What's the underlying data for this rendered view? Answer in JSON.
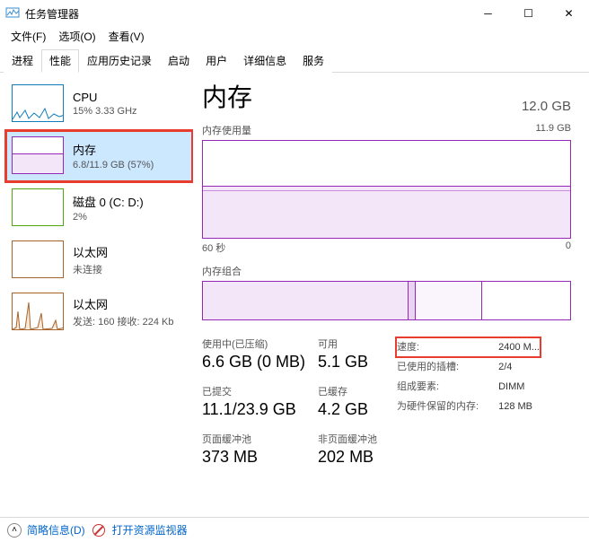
{
  "window": {
    "title": "任务管理器"
  },
  "menu": {
    "file": "文件(F)",
    "options": "选项(O)",
    "view": "查看(V)"
  },
  "tabs": [
    "进程",
    "性能",
    "应用历史记录",
    "启动",
    "用户",
    "详细信息",
    "服务"
  ],
  "sidebar": {
    "cpu": {
      "name": "CPU",
      "sub": "15% 3.33 GHz"
    },
    "mem": {
      "name": "内存",
      "sub": "6.8/11.9 GB (57%)"
    },
    "disk": {
      "name": "磁盘 0 (C: D:)",
      "sub": "2%"
    },
    "eth0": {
      "name": "以太网",
      "sub": "未连接"
    },
    "eth1": {
      "name": "以太网",
      "sub": "发送: 160 接收: 224 Kb"
    }
  },
  "detail": {
    "title": "内存",
    "capacity": "12.0 GB",
    "usage_label": "内存使用量",
    "usage_max": "11.9 GB",
    "axis_left": "60 秒",
    "axis_right": "0",
    "comp_label": "内存组合",
    "stats": {
      "inuse_lbl": "使用中(已压缩)",
      "inuse_val": "6.6 GB (0 MB)",
      "avail_lbl": "可用",
      "avail_val": "5.1 GB",
      "commit_lbl": "已提交",
      "commit_val": "11.1/23.9 GB",
      "cached_lbl": "已缓存",
      "cached_val": "4.2 GB",
      "paged_lbl": "页面缓冲池",
      "paged_val": "373 MB",
      "nonpaged_lbl": "非页面缓冲池",
      "nonpaged_val": "202 MB"
    },
    "meta": {
      "speed_k": "速度:",
      "speed_v": "2400 M...",
      "slots_k": "已使用的插槽:",
      "slots_v": "2/4",
      "form_k": "组成要素:",
      "form_v": "DIMM",
      "hw_k": "为硬件保留的内存:",
      "hw_v": "128 MB"
    }
  },
  "footer": {
    "less": "简略信息(D)",
    "resmon": "打开资源监视器"
  },
  "chart_data": {
    "type": "area",
    "title": "内存使用量",
    "ylim": [
      0,
      11.9
    ],
    "x_label_left": "60 秒",
    "x_label_right": "0",
    "used_gb_approx": 6.8,
    "composition_bars": [
      {
        "label": "in-use",
        "approx_pct": 56
      },
      {
        "label": "modified",
        "approx_pct": 2
      },
      {
        "label": "standby",
        "approx_pct": 18
      }
    ]
  }
}
